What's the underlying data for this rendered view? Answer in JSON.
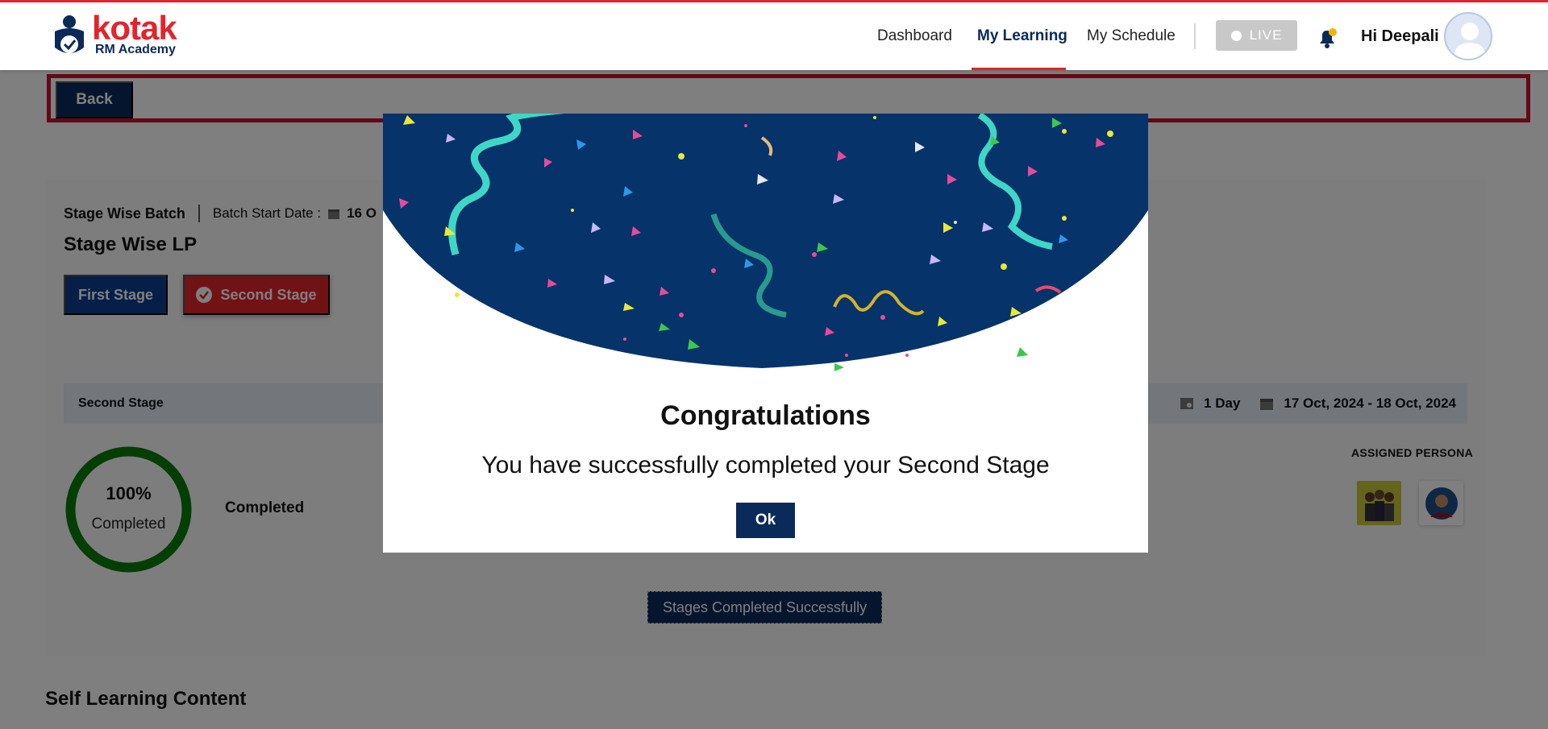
{
  "header": {
    "logo_word": "kotak",
    "logo_sub": "RM Academy",
    "nav": {
      "dashboard": "Dashboard",
      "my_learning": "My Learning",
      "my_schedule": "My Schedule"
    },
    "live_label": "LIVE",
    "greeting": "Hi Deepali"
  },
  "page": {
    "back_label": "Back",
    "batch_name": "Stage Wise Batch",
    "batch_start_label": "Batch Start Date :",
    "batch_start_value": "16 O",
    "lp_title": "Stage Wise LP",
    "stages": [
      "First Stage",
      "Second Stage"
    ],
    "strip_title": "Second Stage",
    "duration": "1 Day",
    "date_range": "17 Oct, 2024 - 18 Oct, 2024",
    "progress_value": "100%",
    "progress_percent": 100,
    "progress_label": "Completed",
    "status_text": "Completed",
    "persona_title": "ASSIGNED PERSONA",
    "stages_done_label": "Stages Completed Successfully",
    "self_learning_title": "Self Learning Content"
  },
  "modal": {
    "title": "Congratulations",
    "message": "You have successfully completed your Second Stage",
    "ok_label": "Ok"
  },
  "colors": {
    "brand_red": "#e3242b",
    "navy": "#0a2a5a",
    "stage_blue": "#0a3f8f",
    "progress_green": "#0a7d0a",
    "confetti_bg": "#06336a"
  },
  "icons": {
    "bell": "bell-icon",
    "avatar": "user-avatar-icon",
    "calendar": "calendar-icon",
    "check": "check-circle-icon",
    "duration": "duration-icon"
  }
}
